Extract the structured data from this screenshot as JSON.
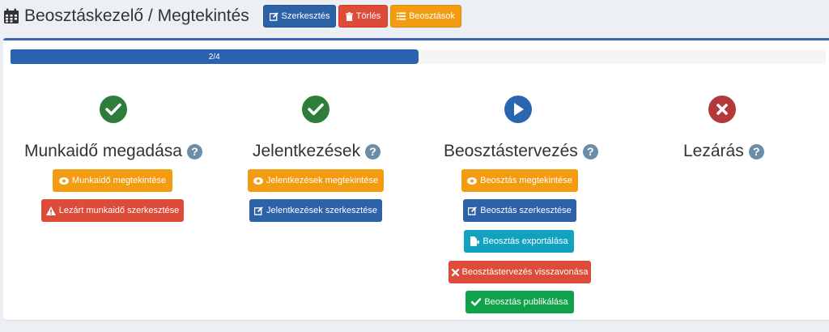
{
  "header": {
    "title": "Beosztáskezelő / Megtekintés",
    "buttons": {
      "edit": "Szerkesztés",
      "delete": "Törlés",
      "list": "Beosztások"
    }
  },
  "progress": {
    "label": "2/4",
    "value": 0.5
  },
  "steps": [
    {
      "title": "Munkaidő megadása",
      "status": "done",
      "buttons": [
        "Munkaidő megtekintése",
        "Lezárt munkaidő szerkesztése"
      ]
    },
    {
      "title": "Jelentkezések",
      "status": "done",
      "buttons": [
        "Jelentkezések megtekintése",
        "Jelentkezések szerkesztése"
      ]
    },
    {
      "title": "Beosztástervezés",
      "status": "in-progress",
      "buttons": [
        "Beosztás megtekintése",
        "Beosztás szerkesztése",
        "Beosztás exportálása",
        "Beosztástervezés visszavonása",
        "Beosztás publikálása"
      ]
    },
    {
      "title": "Lezárás",
      "status": "not-started",
      "buttons": []
    }
  ],
  "colors": {
    "primary": "#2b62a8",
    "danger": "#dd4b39",
    "warning": "#f39c12",
    "info": "#11a2c0",
    "success": "#10a14b",
    "done": "#2e7d3a",
    "in_progress": "#2a65b0",
    "not_started": "#b33a3a"
  },
  "icons": {
    "title": "calendar-icon",
    "edit": "edit-icon",
    "delete": "trash-icon",
    "list": "list-icon",
    "view": "eye-icon",
    "warning": "warning-icon",
    "export": "file-export-icon",
    "undo": "times-icon",
    "publish": "check-icon",
    "help": "question-circle-icon"
  }
}
